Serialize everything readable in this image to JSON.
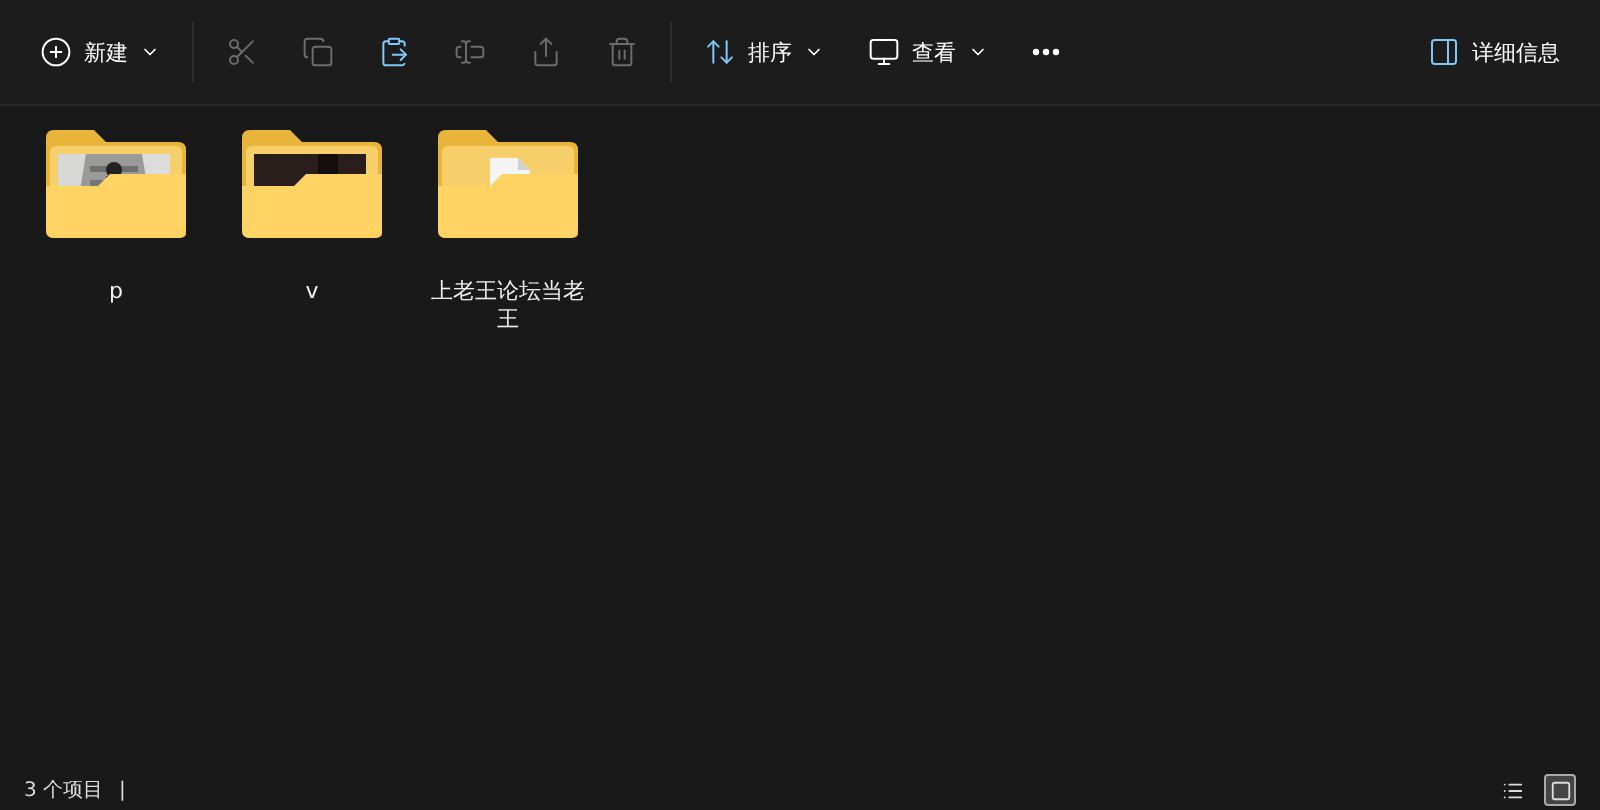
{
  "toolbar": {
    "items": [
      {
        "kind": "new",
        "label": "新建",
        "caret": true,
        "disabled": false
      },
      {
        "kind": "cut",
        "disabled": true
      },
      {
        "kind": "copy",
        "disabled": true
      },
      {
        "kind": "paste",
        "disabled": false
      },
      {
        "kind": "rename",
        "disabled": true
      },
      {
        "kind": "share",
        "disabled": true
      },
      {
        "kind": "delete",
        "disabled": true
      },
      {
        "kind": "sort",
        "label": "排序",
        "caret": true,
        "disabled": false
      },
      {
        "kind": "view",
        "label": "查看",
        "caret": true,
        "disabled": false
      },
      {
        "kind": "more",
        "disabled": false
      }
    ],
    "details": {
      "label": "详细信息"
    }
  },
  "folders": [
    {
      "name": "p"
    },
    {
      "name": "v",
      "kind": "video"
    },
    {
      "name": "上老王论坛当老王",
      "kind": "document"
    }
  ],
  "status_bar": {
    "item_count": "3 个项目",
    "separator": "|",
    "view_buttons": [
      {
        "kind": "details",
        "selected": false
      },
      {
        "kind": "large-icons",
        "selected": true
      }
    ]
  }
}
